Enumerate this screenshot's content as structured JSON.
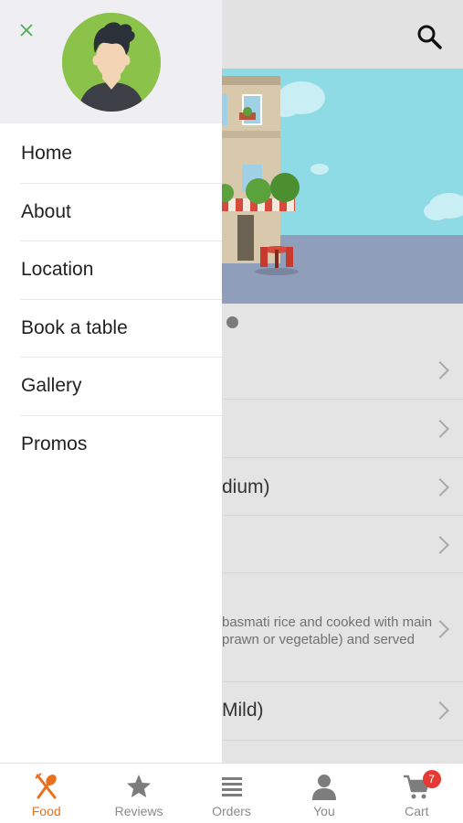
{
  "drawer": {
    "menu": [
      {
        "label": "Home"
      },
      {
        "label": "About"
      },
      {
        "label": "Location"
      },
      {
        "label": "Book a table"
      },
      {
        "label": "Gallery"
      },
      {
        "label": "Promos"
      }
    ]
  },
  "background": {
    "rows": [
      {
        "text": ""
      },
      {
        "text": ""
      },
      {
        "text": "dium)"
      },
      {
        "text": ""
      },
      {
        "desc_line1": "basmati rice and cooked with main",
        "desc_line2": "prawn or vegetable) and served"
      },
      {
        "text": "Mild)"
      }
    ]
  },
  "bottom_nav": {
    "items": [
      {
        "label": "Food",
        "icon": "fork-spoon-icon",
        "active": true
      },
      {
        "label": "Reviews",
        "icon": "star-icon"
      },
      {
        "label": "Orders",
        "icon": "list-icon"
      },
      {
        "label": "You",
        "icon": "person-icon"
      },
      {
        "label": "Cart",
        "icon": "cart-icon",
        "badge": "7"
      }
    ]
  },
  "colors": {
    "accent": "#e8711f",
    "close_icon": "#4caf50",
    "avatar_bg": "#8bc34a",
    "badge": "#e53935"
  }
}
